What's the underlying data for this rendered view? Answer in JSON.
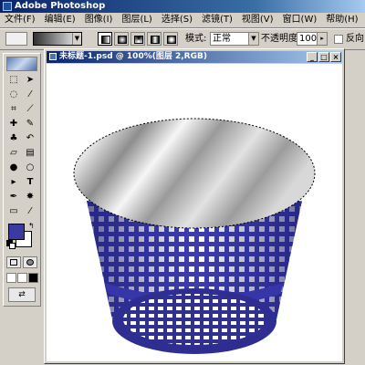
{
  "app": {
    "title": "Adobe Photoshop"
  },
  "menu": [
    "文件(F)",
    "编辑(E)",
    "图像(I)",
    "图层(L)",
    "选择(S)",
    "滤镜(T)",
    "视图(V)",
    "窗口(W)",
    "帮助(H)"
  ],
  "options_bar": {
    "mode_label": "模式:",
    "mode_value": "正常",
    "opacity_label": "不透明度:",
    "opacity_value": "100%",
    "reverse_label": "反向"
  },
  "document": {
    "title": "未标题-1.psd @ 100%(图层 2,RGB)"
  },
  "toolbox": {
    "tools": [
      "rectangular-marquee",
      "move",
      "lasso",
      "magic-wand",
      "crop",
      "slice",
      "healing-brush",
      "brush",
      "clone-stamp",
      "history-brush",
      "eraser",
      "gradient",
      "blur",
      "dodge",
      "path-selection",
      "type",
      "pen",
      "custom-shape",
      "notes",
      "eyedropper",
      "hand",
      "zoom"
    ],
    "foreground_color": "#3a3aa0",
    "background_color": "#ffffff"
  },
  "colors": {
    "basket": "#3d3db0",
    "selection_outline": "#000000"
  }
}
